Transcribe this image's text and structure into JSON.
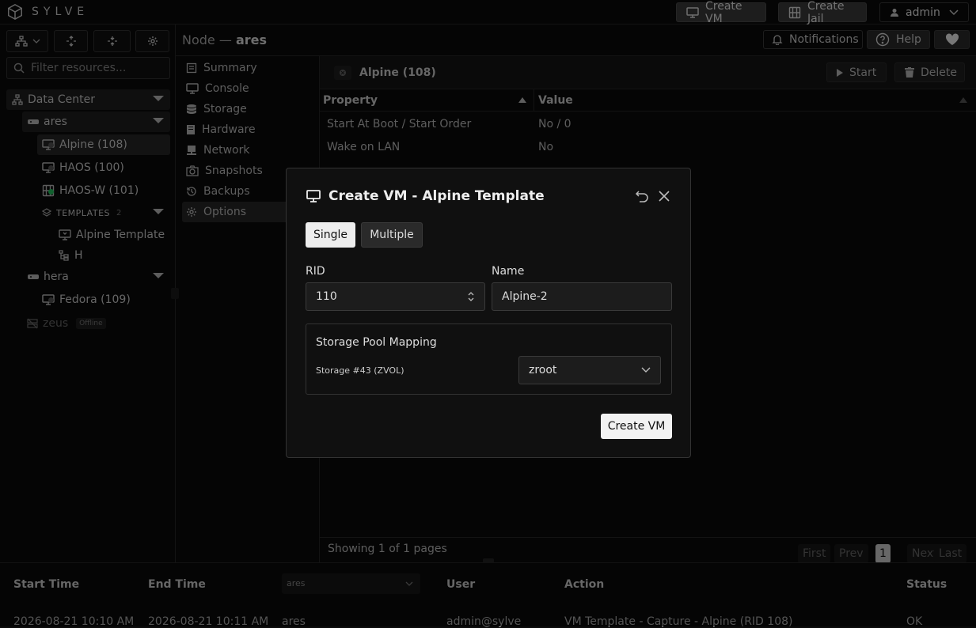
{
  "app": {
    "brand": "SYLVE"
  },
  "topbar": {
    "create_vm": "Create VM",
    "create_jail": "Create Jail",
    "user": "admin"
  },
  "sidebar": {
    "filter_placeholder": "Filter resources...",
    "tree": {
      "datacenter": "Data Center",
      "nodes": [
        {
          "name": "ares",
          "vms": [
            "Alpine (108)",
            "HAOS (100)",
            "HAOS-W (101)"
          ],
          "templates_label": "TEMPLATES",
          "templates_count": "2",
          "templates": [
            "Alpine Template",
            "H"
          ]
        },
        {
          "name": "hera",
          "vms": [
            "Fedora (109)"
          ]
        },
        {
          "name": "zeus",
          "status": "Offline"
        }
      ]
    }
  },
  "node_header": {
    "prefix": "Node —",
    "name": "ares",
    "notifications": "Notifications",
    "help": "Help"
  },
  "nav": [
    "Summary",
    "Console",
    "Storage",
    "Hardware",
    "Network",
    "Snapshots",
    "Backups",
    "Options"
  ],
  "content": {
    "vm_title": "Alpine (108)",
    "start": "Start",
    "delete": "Delete",
    "columns": [
      "Property",
      "Value"
    ],
    "rows": [
      {
        "property": "Start At Boot / Start Order",
        "value": "No / 0"
      },
      {
        "property": "Wake on LAN",
        "value": "No"
      }
    ],
    "pager": {
      "info": "Showing 1 of 1 pages",
      "first": "First",
      "prev": "Prev",
      "page": "1",
      "next": "Next",
      "last": "Last"
    }
  },
  "logs": {
    "columns": [
      "Start Time",
      "End Time",
      "ares",
      "User",
      "Action",
      "Status"
    ],
    "row": {
      "start": "2026-08-21 10:10 AM",
      "end": "2026-08-21 10:11 AM",
      "node": "ares",
      "user": "admin@sylve",
      "action": "VM Template - Capture - Alpine (RID 108)",
      "status": "OK"
    }
  },
  "modal": {
    "title": "Create VM - Alpine Template",
    "mode_single": "Single",
    "mode_multiple": "Multiple",
    "rid_label": "RID",
    "rid_value": "110",
    "name_label": "Name",
    "name_value": "Alpine-2",
    "pool_title": "Storage Pool Mapping",
    "pool_source": "Storage #43 (ZVOL)",
    "pool_target": "zroot",
    "submit": "Create VM"
  },
  "colors": {
    "accent_green": "#22c55e",
    "offline_gray": "#555555",
    "primary_button": "#f2f2f2"
  }
}
